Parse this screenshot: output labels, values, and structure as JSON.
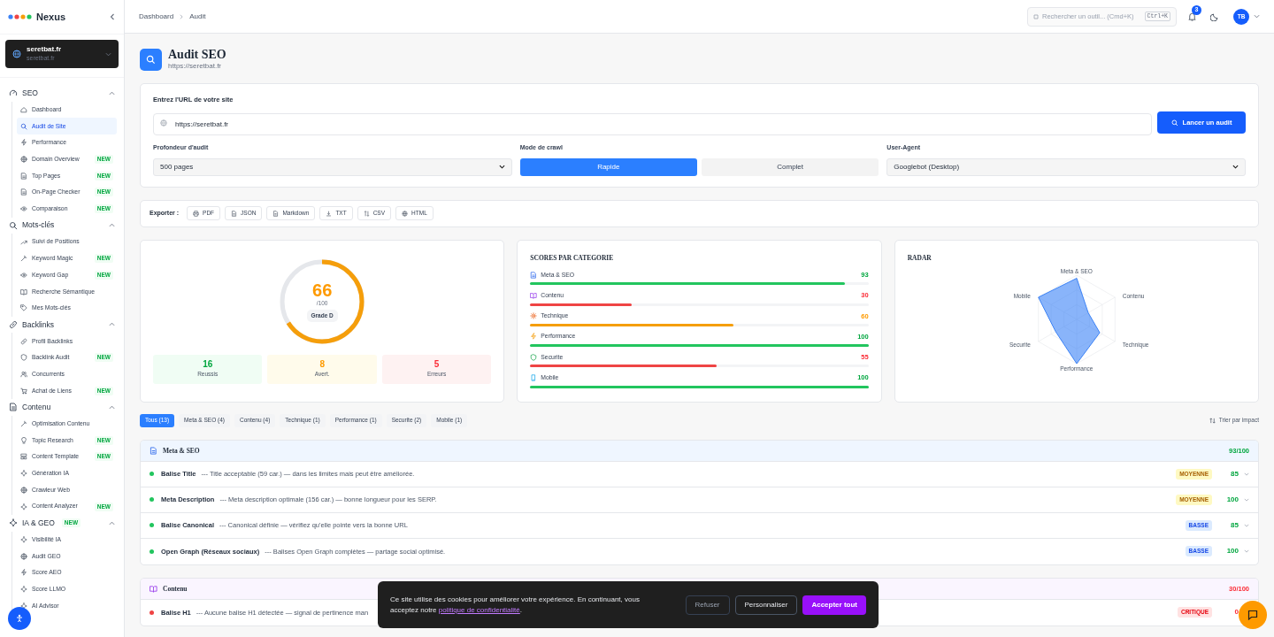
{
  "brand": {
    "name": "Nexus"
  },
  "site": {
    "name": "seretbat.fr",
    "domain": "seretbat.fr"
  },
  "sidebar": [
    {
      "label": "SEO",
      "expanded": true,
      "children": [
        {
          "label": "Dashboard",
          "selected": false
        },
        {
          "label": "Audit de Site",
          "selected": true
        },
        {
          "label": "Performance",
          "selected": false
        },
        {
          "label": "Domain Overview",
          "selected": false,
          "badge": "NEW"
        },
        {
          "label": "Top Pages",
          "selected": false,
          "badge": "NEW"
        },
        {
          "label": "On-Page Checker",
          "selected": false,
          "badge": "NEW"
        },
        {
          "label": "Comparaison",
          "selected": false,
          "badge": "NEW"
        }
      ]
    },
    {
      "label": "Mots-clés",
      "expanded": true,
      "children": [
        {
          "label": "Suivi de Positions",
          "selected": false
        },
        {
          "label": "Keyword Magic",
          "selected": false,
          "badge": "NEW"
        },
        {
          "label": "Keyword Gap",
          "selected": false,
          "badge": "NEW"
        },
        {
          "label": "Recherche Sémantique",
          "selected": false
        },
        {
          "label": "Mes Mots-clés",
          "selected": false
        }
      ]
    },
    {
      "label": "Backlinks",
      "expanded": true,
      "children": [
        {
          "label": "Profil Backlinks",
          "selected": false
        },
        {
          "label": "Backlink Audit",
          "selected": false,
          "badge": "NEW"
        },
        {
          "label": "Concurrents",
          "selected": false
        },
        {
          "label": "Achat de Liens",
          "selected": false,
          "badge": "NEW"
        }
      ]
    },
    {
      "label": "Contenu",
      "expanded": true,
      "children": [
        {
          "label": "Optimisation Contenu",
          "selected": false
        },
        {
          "label": "Topic Research",
          "selected": false,
          "badge": "NEW"
        },
        {
          "label": "Content Template",
          "selected": false,
          "badge": "NEW"
        },
        {
          "label": "Génération IA",
          "selected": false
        },
        {
          "label": "Crawleur Web",
          "selected": false
        },
        {
          "label": "Content Analyzer",
          "selected": false,
          "badge": "NEW"
        }
      ]
    },
    {
      "label": "IA & GEO",
      "expanded": true,
      "badge": "NEW",
      "children": [
        {
          "label": "Visibilité IA",
          "selected": false
        },
        {
          "label": "Audit GEO",
          "selected": false
        },
        {
          "label": "Score AEO",
          "selected": false
        },
        {
          "label": "Score LLMO",
          "selected": false
        },
        {
          "label": "AI Advisor",
          "selected": false
        }
      ]
    }
  ],
  "breadcrumb": [
    "Dashboard",
    "Audit"
  ],
  "search": {
    "placeholder": "Rechercher un outil... (Cmd+K)",
    "shortcut": "Ctrl+K"
  },
  "notifications": {
    "count": "3"
  },
  "user": {
    "initials": "TB"
  },
  "page": {
    "title": "Audit SEO",
    "subtitle": "https://seretbat.fr"
  },
  "form": {
    "url_label": "Entrez l'URL de votre site",
    "url_value": "https://seretbat.fr",
    "submit": "Lancer un audit",
    "depth_label": "Profondeur d'audit",
    "depth_value": "500 pages",
    "mode_label": "Mode de crawl",
    "modes": [
      {
        "label": "Rapide",
        "selected": true
      },
      {
        "label": "Complet",
        "selected": false
      }
    ],
    "agent_label": "User-Agent",
    "agent_value": "Googlebot (Desktop)"
  },
  "export": {
    "label": "Exporter :",
    "buttons": [
      "PDF",
      "JSON",
      "Markdown",
      "TXT",
      "CSV",
      "HTML"
    ]
  },
  "score": {
    "value": "66",
    "max": "/100",
    "grade": "Grade D",
    "level": 0.66,
    "stats": [
      {
        "value": "16",
        "label": "Reussis",
        "kind": "success"
      },
      {
        "value": "8",
        "label": "Avert.",
        "kind": "warning"
      },
      {
        "value": "5",
        "label": "Erreurs",
        "kind": "error"
      }
    ]
  },
  "categories": {
    "title": "SCORES PAR CATEGORIE",
    "items": [
      {
        "label": "Meta & SEO",
        "score": "93",
        "level": 0.93,
        "kind": "good"
      },
      {
        "label": "Contenu",
        "score": "30",
        "level": 0.3,
        "kind": "bad"
      },
      {
        "label": "Technique",
        "score": "60",
        "level": 0.6,
        "kind": "warn"
      },
      {
        "label": "Performance",
        "score": "100",
        "level": 1,
        "kind": "good"
      },
      {
        "label": "Securite",
        "score": "55",
        "level": 0.55,
        "kind": "bad"
      },
      {
        "label": "Mobile",
        "score": "100",
        "level": 1,
        "kind": "good"
      }
    ]
  },
  "radar": {
    "title": "RADAR",
    "axes": [
      "Meta & SEO",
      "Contenu",
      "Technique",
      "Performance",
      "Securite",
      "Mobile"
    ]
  },
  "filters": [
    {
      "label": "Tous (13)",
      "selected": true
    },
    {
      "label": "Meta & SEO (4)",
      "selected": false
    },
    {
      "label": "Contenu (4)",
      "selected": false
    },
    {
      "label": "Technique (1)",
      "selected": false
    },
    {
      "label": "Performance (1)",
      "selected": false
    },
    {
      "label": "Securite (2)",
      "selected": false
    },
    {
      "label": "Mobile (1)",
      "selected": false
    }
  ],
  "sort": "Trier par impact",
  "sections": [
    {
      "title": "Meta & SEO",
      "score": "93/100",
      "kind": "good",
      "rows": [
        {
          "name": "Balise Title",
          "detail": "--- Title acceptable (59 car.) — dans les limites mais peut être améliorée.",
          "badge": "MOYENNE",
          "kind": "medium",
          "score": "85",
          "color": "#22c55e"
        },
        {
          "name": "Meta Description",
          "detail": "--- Meta description optimale (156 car.) — bonne longueur pour les SERP.",
          "badge": "MOYENNE",
          "kind": "medium",
          "score": "100",
          "color": "#22c55e"
        },
        {
          "name": "Balise Canonical",
          "detail": "--- Canonical définie — vérifiez qu'elle pointe vers la bonne URL",
          "badge": "BASSE",
          "kind": "low",
          "score": "85",
          "color": "#22c55e"
        },
        {
          "name": "Open Graph (Réseaux sociaux)",
          "detail": "--- Balises Open Graph complètes — partage social optimisé.",
          "badge": "BASSE",
          "kind": "low",
          "score": "100",
          "color": "#22c55e"
        }
      ]
    },
    {
      "title": "Contenu",
      "score": "30/100",
      "kind": "bad",
      "rows": [
        {
          "name": "Balise H1",
          "detail": "--- Aucune balise H1 détectée — signal de pertinence man",
          "badge": "CRITIQUE",
          "kind": "critical",
          "score": "0",
          "color": "#ef4444"
        }
      ]
    }
  ],
  "cookie": {
    "text": "Ce site utilise des cookies pour améliorer votre expérience. En continuant, vous acceptez notre",
    "link": "politique de confidentialité",
    "end": ".",
    "buttons": [
      "Refuser",
      "Personnaliser",
      "Accepter tout"
    ]
  }
}
